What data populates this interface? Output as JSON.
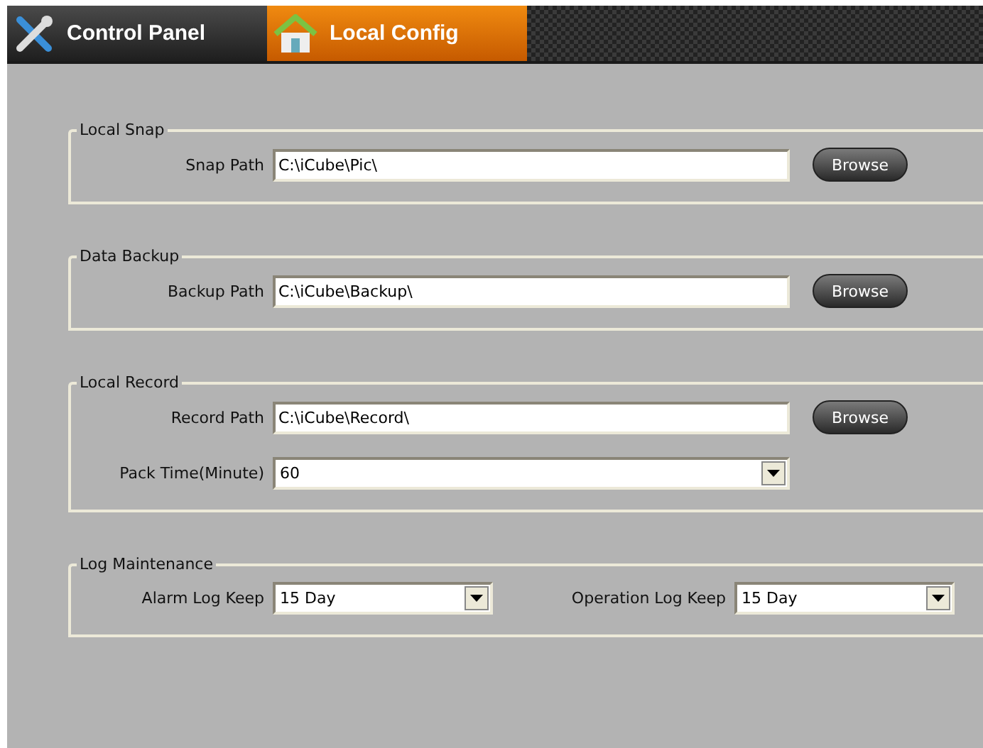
{
  "tabs": [
    {
      "label": "Control Panel",
      "selected": false
    },
    {
      "label": "Local Config",
      "selected": true
    }
  ],
  "sections": [
    {
      "title": "Local Snap",
      "rows": [
        [
          {
            "kind": "path",
            "label": "Snap Path",
            "value": "C:\\iCube\\Pic\\",
            "button": "Browse"
          }
        ]
      ]
    },
    {
      "title": "Data Backup",
      "rows": [
        [
          {
            "kind": "path",
            "label": "Backup Path",
            "value": "C:\\iCube\\Backup\\",
            "button": "Browse"
          }
        ]
      ]
    },
    {
      "title": "Local Record",
      "rows": [
        [
          {
            "kind": "path",
            "label": "Record Path",
            "value": "C:\\iCube\\Record\\",
            "button": "Browse"
          }
        ],
        [
          {
            "kind": "select",
            "label": "Pack Time(Minute)",
            "value": "60"
          }
        ]
      ]
    },
    {
      "title": "Log Maintenance",
      "rows": [
        [
          {
            "kind": "small-select",
            "label": "Alarm Log Keep",
            "value": "15 Day"
          },
          {
            "kind": "small-select",
            "label": "Operation Log Keep",
            "value": "15 Day"
          }
        ]
      ]
    }
  ]
}
